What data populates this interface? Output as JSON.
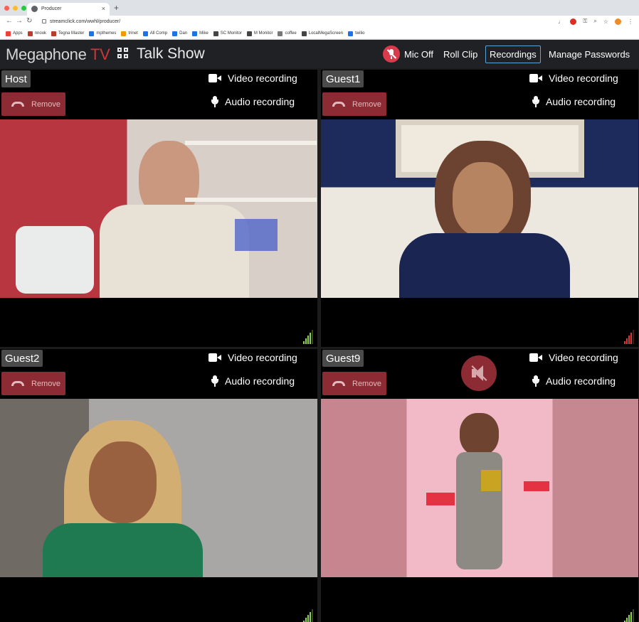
{
  "browser": {
    "tab_title": "Producer",
    "url": "streamclick.com/wwhl/producer/",
    "new_tab_symbol": "+",
    "tab_close_symbol": "×",
    "bookmarks": [
      {
        "label": "Apps",
        "color": "#ea4335"
      },
      {
        "label": "nnook",
        "color": "#c0392b"
      },
      {
        "label": "Tegna Master",
        "color": "#c0392b"
      },
      {
        "label": "mpthemes",
        "color": "#1a73e8"
      },
      {
        "label": "trinet",
        "color": "#f29900"
      },
      {
        "label": "All Comp",
        "color": "#1a73e8"
      },
      {
        "label": "Dan",
        "color": "#1a73e8"
      },
      {
        "label": "Mike",
        "color": "#1a73e8"
      },
      {
        "label": "SC Monitor",
        "color": "#444444"
      },
      {
        "label": "M Monitor",
        "color": "#444444"
      },
      {
        "label": "coffee",
        "color": "#777777"
      },
      {
        "label": "LocalMegaScreen",
        "color": "#444444"
      },
      {
        "label": "twilio",
        "color": "#1a73e8"
      }
    ],
    "profile_color": "#f08a24"
  },
  "header": {
    "brand_name": "Megaphone",
    "brand_suffix": "TV",
    "show_title": "Talk Show",
    "mic_off_label": "Mic Off",
    "roll_clip_label": "Roll Clip",
    "recordings_label": "Recordings",
    "manage_passwords_label": "Manage Passwords"
  },
  "tiles": [
    {
      "label": "Host",
      "remove_label": "Remove",
      "video_recording": "Video recording",
      "audio_recording": "Audio recording",
      "signal_bars": 4,
      "signal_color": "#8fd14f",
      "muted": false
    },
    {
      "label": "Guest1",
      "remove_label": "Remove",
      "video_recording": "Video recording",
      "audio_recording": "Audio recording",
      "signal_bars": 4,
      "signal_color": "#cf3a3a",
      "muted": false
    },
    {
      "label": "Guest2",
      "remove_label": "Remove",
      "video_recording": "Video recording",
      "audio_recording": "Audio recording",
      "signal_bars": 4,
      "signal_color": "#8fd14f",
      "muted": false
    },
    {
      "label": "Guest9",
      "remove_label": "Remove",
      "video_recording": "Video recording",
      "audio_recording": "Audio recording",
      "signal_bars": 4,
      "signal_color": "#8fd14f",
      "muted": true
    }
  ],
  "colors": {
    "accent_red": "#d93a4c",
    "remove_bg": "#8c2b33",
    "active_border": "#5aa3d8"
  }
}
